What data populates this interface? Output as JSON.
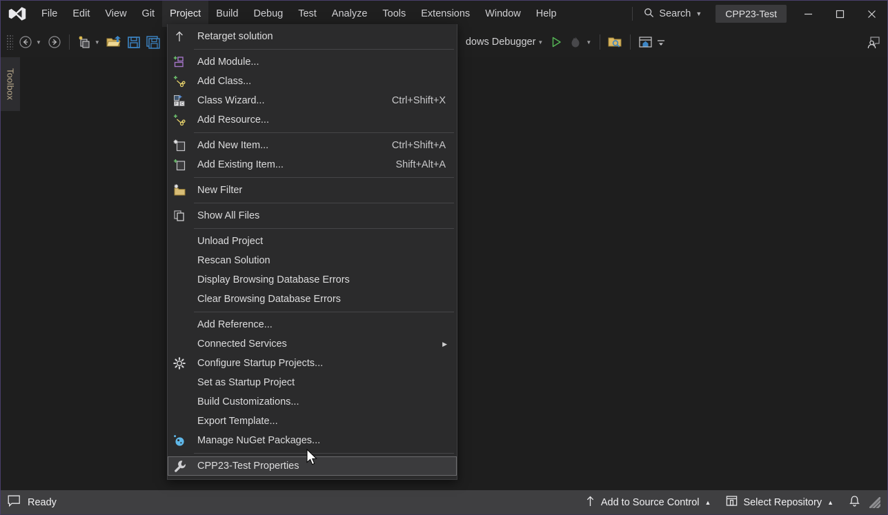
{
  "window": {
    "project_chip": "CPP23-Test",
    "minimize": "—",
    "maximize": "☐",
    "close": "✕"
  },
  "menubar": {
    "items": [
      {
        "label": "File",
        "active": false
      },
      {
        "label": "Edit",
        "active": false
      },
      {
        "label": "View",
        "active": false
      },
      {
        "label": "Git",
        "active": false
      },
      {
        "label": "Project",
        "active": true
      },
      {
        "label": "Build",
        "active": false
      },
      {
        "label": "Debug",
        "active": false
      },
      {
        "label": "Test",
        "active": false
      },
      {
        "label": "Analyze",
        "active": false
      },
      {
        "label": "Tools",
        "active": false
      },
      {
        "label": "Extensions",
        "active": false
      },
      {
        "label": "Window",
        "active": false
      },
      {
        "label": "Help",
        "active": false
      }
    ],
    "search_label": "Search"
  },
  "toolbar": {
    "debug_target": "dows Debugger",
    "debug_target_full": "Local Windows Debugger"
  },
  "toolbox": {
    "label": "Toolbox"
  },
  "project_menu": {
    "title": "Project",
    "items": [
      {
        "type": "item",
        "icon": "arrow-up-icon",
        "label": "Retarget solution",
        "shortcut": ""
      },
      {
        "type": "separator"
      },
      {
        "type": "item",
        "icon": "add-module-icon",
        "label": "Add Module...",
        "shortcut": ""
      },
      {
        "type": "item",
        "icon": "add-class-icon",
        "label": "Add Class...",
        "shortcut": ""
      },
      {
        "type": "item",
        "icon": "class-wizard-icon",
        "label": "Class Wizard...",
        "shortcut": "Ctrl+Shift+X"
      },
      {
        "type": "item",
        "icon": "add-resource-icon",
        "label": "Add Resource...",
        "shortcut": ""
      },
      {
        "type": "separator"
      },
      {
        "type": "item",
        "icon": "add-new-item-icon",
        "label": "Add New Item...",
        "shortcut": "Ctrl+Shift+A"
      },
      {
        "type": "item",
        "icon": "add-existing-item-icon",
        "label": "Add Existing Item...",
        "shortcut": "Shift+Alt+A"
      },
      {
        "type": "separator"
      },
      {
        "type": "item",
        "icon": "new-filter-icon",
        "label": "New Filter",
        "shortcut": ""
      },
      {
        "type": "separator"
      },
      {
        "type": "item",
        "icon": "show-all-files-icon",
        "label": "Show All Files",
        "shortcut": ""
      },
      {
        "type": "separator"
      },
      {
        "type": "item",
        "icon": "none",
        "label": "Unload Project",
        "shortcut": ""
      },
      {
        "type": "item",
        "icon": "none",
        "label": "Rescan Solution",
        "shortcut": ""
      },
      {
        "type": "item",
        "icon": "none",
        "label": "Display Browsing Database Errors",
        "shortcut": ""
      },
      {
        "type": "item",
        "icon": "none",
        "label": "Clear Browsing Database Errors",
        "shortcut": ""
      },
      {
        "type": "separator"
      },
      {
        "type": "item",
        "icon": "none",
        "label": "Add Reference...",
        "shortcut": ""
      },
      {
        "type": "submenu",
        "icon": "none",
        "label": "Connected Services",
        "shortcut": ""
      },
      {
        "type": "item",
        "icon": "gear-icon",
        "label": "Configure Startup Projects...",
        "shortcut": ""
      },
      {
        "type": "item",
        "icon": "none",
        "label": "Set as Startup Project",
        "shortcut": ""
      },
      {
        "type": "item",
        "icon": "none",
        "label": "Build Customizations...",
        "shortcut": ""
      },
      {
        "type": "item",
        "icon": "none",
        "label": "Export Template...",
        "shortcut": ""
      },
      {
        "type": "item",
        "icon": "nuget-icon",
        "label": "Manage NuGet Packages...",
        "shortcut": ""
      },
      {
        "type": "separator"
      },
      {
        "type": "highlight",
        "icon": "wrench-icon",
        "label": "CPP23-Test Properties",
        "shortcut": ""
      }
    ]
  },
  "statusbar": {
    "ready": "Ready",
    "add_to_source_control": "Add to Source Control",
    "select_repository": "Select Repository"
  },
  "colors": {
    "window_bg": "#1e1e1e",
    "chrome_bg": "#1f1f1f",
    "menu_bg": "#2b2b2c",
    "status_bg": "#3f3f41",
    "accent_border": "#4a3f6b",
    "highlight": "#3b3b3d",
    "text": "#dcdcdd",
    "toolbox_text": "#b9a98a",
    "run_green": "#55b555"
  }
}
